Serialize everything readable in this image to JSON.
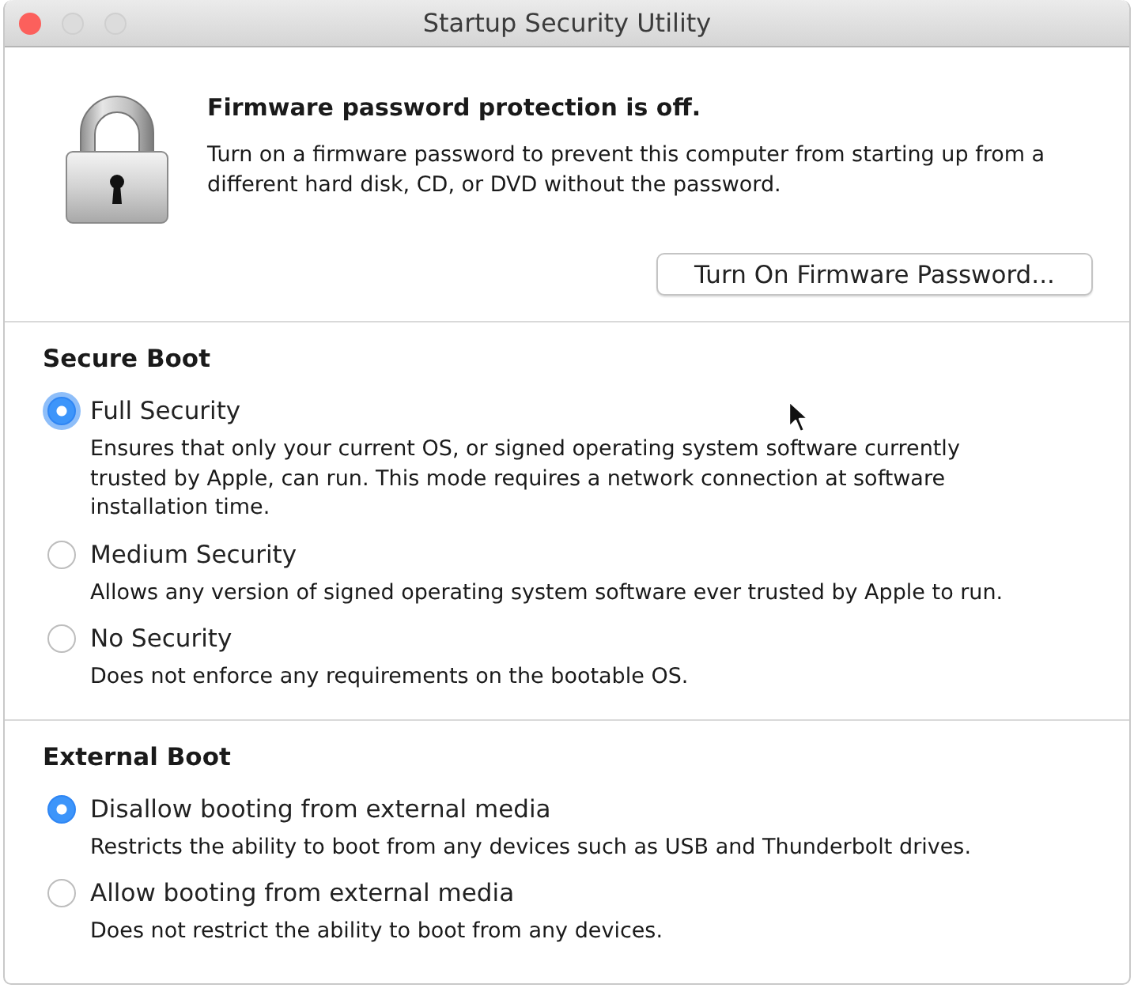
{
  "window": {
    "title": "Startup Security Utility",
    "controls": [
      {
        "kind": "close",
        "disabled": false
      },
      {
        "kind": "minimize",
        "disabled": true
      },
      {
        "kind": "zoom",
        "disabled": true
      }
    ]
  },
  "firmware": {
    "heading": "Firmware password protection is off.",
    "description": "Turn on a firmware password to prevent this computer from starting up from a different hard disk, CD, or DVD without the password.",
    "button": "Turn On Firmware Password..."
  },
  "sections": [
    {
      "title": "Secure Boot",
      "options": [
        {
          "label": "Full Security",
          "description": "Ensures that only your current OS, or signed operating system software currently trusted by Apple, can run. This mode requires a network connection at software installation time.",
          "selected": true,
          "focused": true
        },
        {
          "label": "Medium Security",
          "description": "Allows any version of signed operating system software ever trusted by Apple to run.",
          "selected": false,
          "focused": false
        },
        {
          "label": "No Security",
          "description": "Does not enforce any requirements on the bootable OS.",
          "selected": false,
          "focused": false
        }
      ]
    },
    {
      "title": "External Boot",
      "options": [
        {
          "label": "Disallow booting from external media",
          "description": "Restricts the ability to boot from any devices such as USB and Thunderbolt drives.",
          "selected": true,
          "focused": false
        },
        {
          "label": "Allow booting from external media",
          "description": "Does not restrict the ability to boot from any devices.",
          "selected": false,
          "focused": false
        }
      ]
    }
  ]
}
